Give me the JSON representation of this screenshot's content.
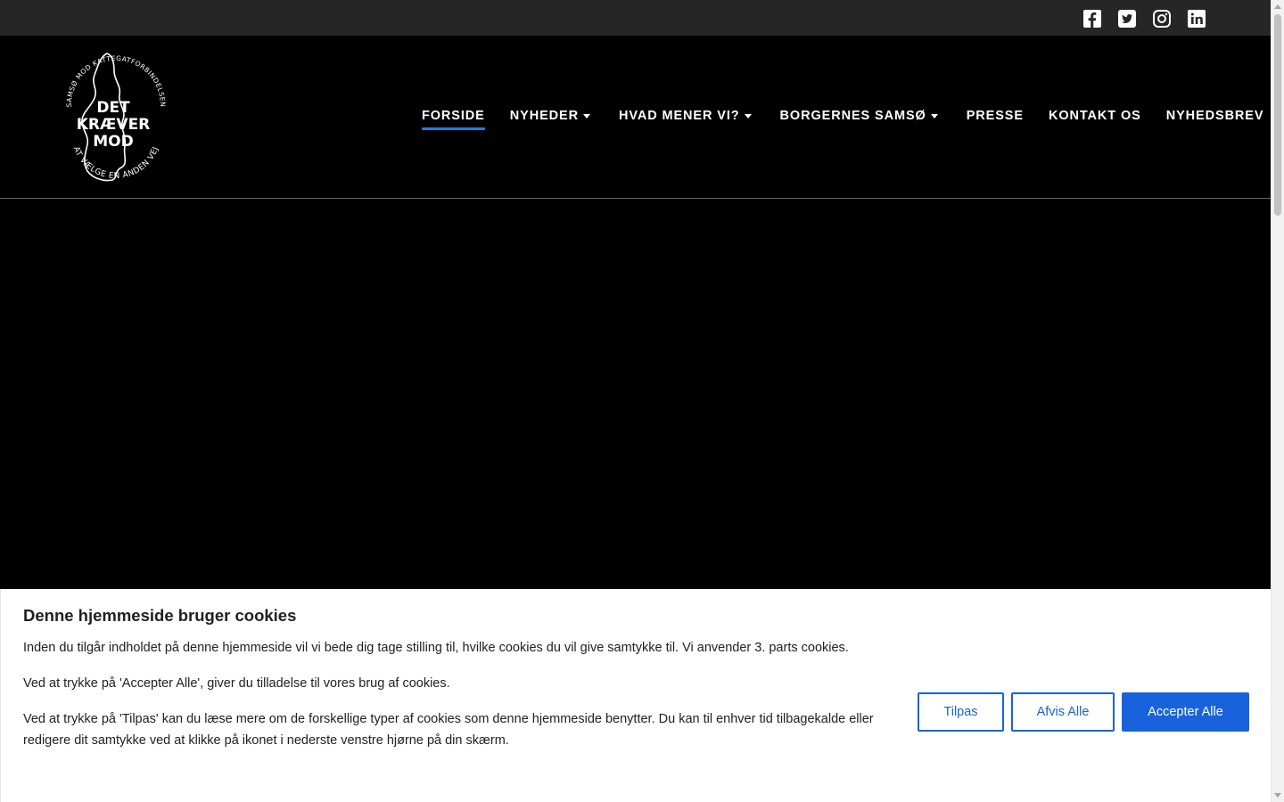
{
  "social": {
    "icons": [
      "facebook-icon",
      "twitter-icon",
      "instagram-icon",
      "linkedin-icon"
    ]
  },
  "logo": {
    "arc_top": "SAMSØ MOD KATTEGATFORBINDELSEN",
    "line1": "DET",
    "line2": "KRÆVER",
    "line3": "MOD",
    "arc_bottom": "AT VÆLGE EN ANDEN VEJ"
  },
  "nav": {
    "items": [
      {
        "label": "FORSIDE",
        "active": true,
        "dropdown": false
      },
      {
        "label": "NYHEDER",
        "active": false,
        "dropdown": true
      },
      {
        "label": "HVAD MENER VI?",
        "active": false,
        "dropdown": true
      },
      {
        "label": "BORGERNES SAMSØ",
        "active": false,
        "dropdown": true
      },
      {
        "label": "PRESSE",
        "active": false,
        "dropdown": false
      },
      {
        "label": "KONTAKT OS",
        "active": false,
        "dropdown": false
      },
      {
        "label": "NYHEDSBREV",
        "active": false,
        "dropdown": false
      }
    ]
  },
  "cookie": {
    "title": "Denne hjemmeside bruger cookies",
    "p1": "Inden du tilgår indholdet på denne hjemmeside vil vi bede dig tage stilling til, hvilke cookies du vil give samtykke til. Vi anvender 3. parts cookies.",
    "p2": "Ved at trykke på 'Accepter Alle',  giver du tilladelse til vores brug af cookies.",
    "p3": "Ved at trykke på 'Tilpas' kan du læse mere om de forskellige typer af cookies som denne hjemmeside benytter. Du kan til enhver tid tilbagekalde eller redigere dit samtykke ved at klikke på ikonet i nederste venstre hjørne på din skærm.",
    "buttons": {
      "customize": "Tilpas",
      "reject": "Afvis Alle",
      "accept": "Accepter Alle"
    }
  },
  "colors": {
    "accent": "#1863dc",
    "nav_underline": "#1e7fd8",
    "topbar": "#262626",
    "header": "#000000"
  }
}
